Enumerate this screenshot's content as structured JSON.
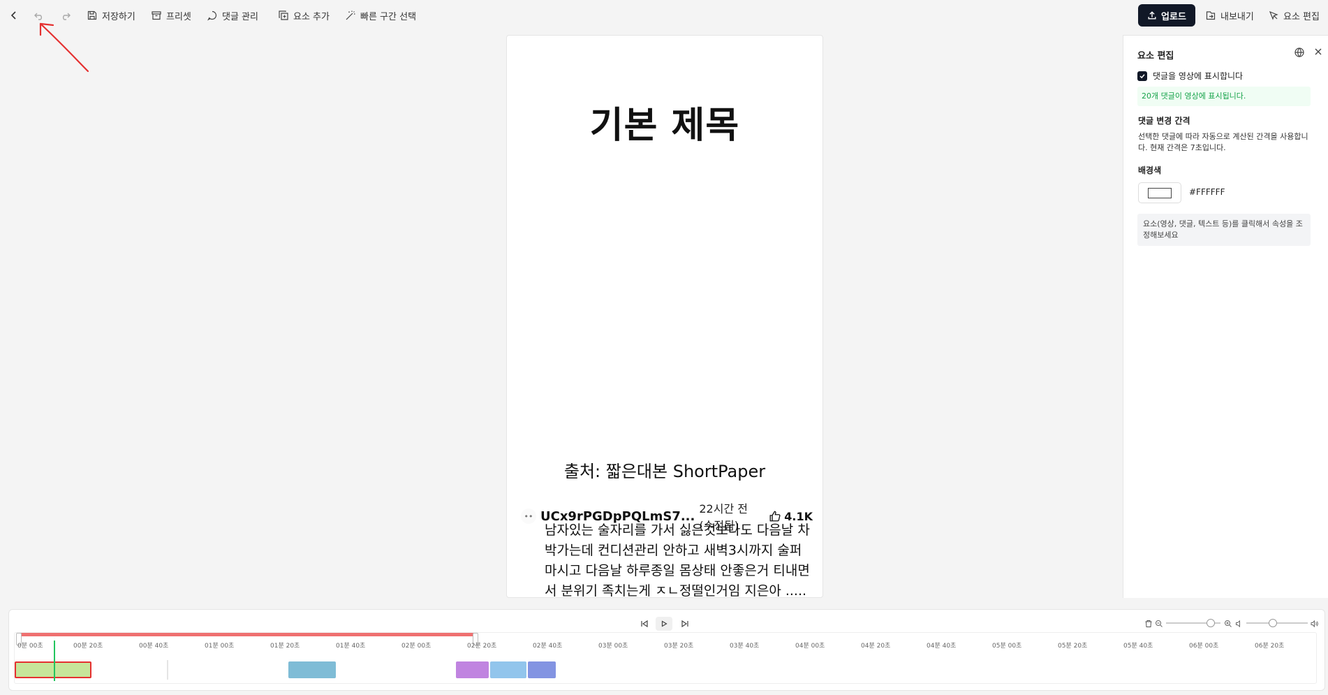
{
  "toolbar": {
    "save_label": "저장하기",
    "preset_label": "프리셋",
    "comments_label": "댓글 관리",
    "add_element_label": "요소 추가",
    "quick_select_label": "빠른 구간 선택",
    "upload_label": "업로드",
    "export_label": "내보내기",
    "edit_element_label": "요소 편집"
  },
  "preview": {
    "title": "기본 제목",
    "source": "출처: 짧은대본 ShortPaper",
    "comment": {
      "author": "UCx9rPGDpPQLmS7...",
      "time": "22시간 전 (수정됨)",
      "likes": "4.1K",
      "text": "남자있는 술자리를 가서 싫은것보다도 다음날 차박가는데 컨디션관리 안하고 새벽3시까지 술퍼마시고 다음날 하루종일 몸상태 안좋은거 티내면서 분위기 족치는게 ㅈㄴ정떨인거임 지은아 ....."
    }
  },
  "panel": {
    "title": "요소 편집",
    "show_comments_label": "댓글을 영상에 표시합니다",
    "notice": "20개 댓글이 영상에 표시됩니다.",
    "interval_label": "댓글 변경 간격",
    "interval_desc": "선택한 댓글에 따라 자동으로 계산된 간격을 사용합니다. 현재 간격은 7초입니다.",
    "bg_label": "배경색",
    "bg_value": "#FFFFFF",
    "hint": "요소(영상, 댓글, 텍스트 등)를 클릭해서 속성을 조정해보세요"
  },
  "timeline": {
    "ticks": [
      "0분 00초",
      "00분 20초",
      "00분 40초",
      "01분 00초",
      "01분 20초",
      "01분 40초",
      "02분 00초",
      "02분 20초",
      "02분 40초",
      "03분 00초",
      "03분 20초",
      "03분 40초",
      "04분 00초",
      "04분 20초",
      "04분 40초",
      "05분 00초",
      "05분 20초",
      "05분 40초",
      "06분 00초",
      "06분 20초"
    ],
    "clip_colors": [
      "#c7e59a",
      "#7fbcd6",
      "#c084e0",
      "#92c5ec",
      "#8394e2"
    ],
    "accent": "#ef7070",
    "playhead_color": "#22c55e"
  }
}
